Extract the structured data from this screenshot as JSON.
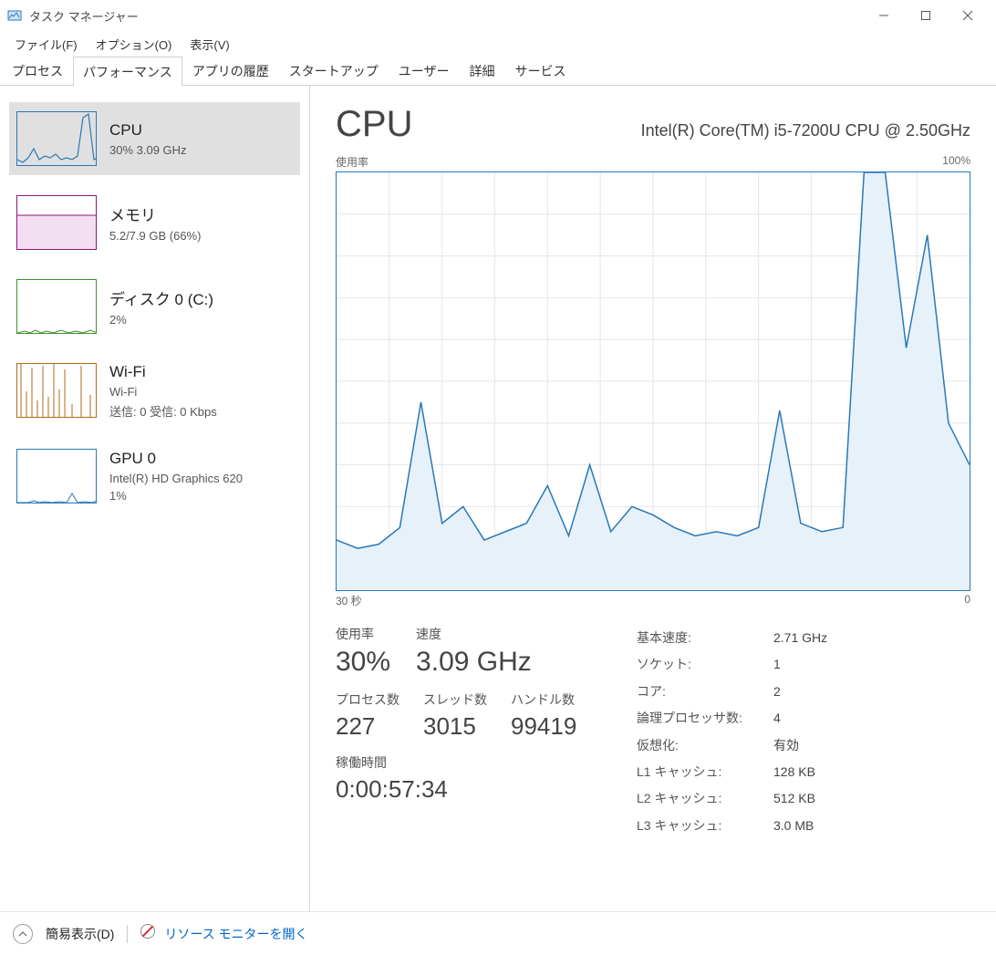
{
  "window": {
    "title": "タスク マネージャー"
  },
  "menu": {
    "file": "ファイル(F)",
    "options": "オプション(O)",
    "view": "表示(V)"
  },
  "tabs": {
    "processes": "プロセス",
    "performance": "パフォーマンス",
    "app_history": "アプリの履歴",
    "startup": "スタートアップ",
    "users": "ユーザー",
    "details": "詳細",
    "services": "サービス"
  },
  "sidebar": {
    "cpu": {
      "title": "CPU",
      "sub": "30%  3.09 GHz",
      "color": "#2878b8"
    },
    "mem": {
      "title": "メモリ",
      "sub": "5.2/7.9 GB (66%)",
      "color": "#8b177d"
    },
    "disk": {
      "title": "ディスク 0 (C:)",
      "sub": "2%",
      "color": "#3f8f2e"
    },
    "wifi": {
      "title": "Wi-Fi",
      "sub": "Wi-Fi",
      "sub2": "送信: 0  受信: 0 Kbps",
      "color": "#b06a1b"
    },
    "gpu": {
      "title": "GPU 0",
      "sub": "Intel(R) HD Graphics 620",
      "sub2": "1%",
      "color": "#2878b8"
    }
  },
  "cpu": {
    "heading": "CPU",
    "model": "Intel(R) Core(TM) i5-7200U CPU @ 2.50GHz",
    "chart_top_left": "使用率",
    "chart_top_right": "100%",
    "chart_bottom_left": "30 秒",
    "chart_bottom_right": "0",
    "stats": {
      "usage_label": "使用率",
      "usage_value": "30%",
      "speed_label": "速度",
      "speed_value": "3.09 GHz",
      "processes_label": "プロセス数",
      "processes_value": "227",
      "threads_label": "スレッド数",
      "threads_value": "3015",
      "handles_label": "ハンドル数",
      "handles_value": "99419",
      "uptime_label": "稼働時間",
      "uptime_value": "0:00:57:34"
    },
    "spec": {
      "base_speed_k": "基本速度:",
      "base_speed_v": "2.71 GHz",
      "sockets_k": "ソケット:",
      "sockets_v": "1",
      "cores_k": "コア:",
      "cores_v": "2",
      "logical_k": "論理プロセッサ数:",
      "logical_v": "4",
      "virt_k": "仮想化:",
      "virt_v": "有効",
      "l1_k": "L1 キャッシュ:",
      "l1_v": "128 KB",
      "l2_k": "L2 キャッシュ:",
      "l2_v": "512 KB",
      "l3_k": "L3 キャッシュ:",
      "l3_v": "3.0 MB"
    }
  },
  "footer": {
    "fewer": "簡易表示(D)",
    "resmon": "リソース モニターを開く"
  },
  "chart_data": {
    "type": "line",
    "title": "CPU 使用率",
    "xlabel": "30 秒",
    "ylabel": "使用率",
    "ylim": [
      0,
      100
    ],
    "x_seconds_ago": [
      30,
      29,
      28,
      27,
      26,
      25,
      24,
      23,
      22,
      21,
      20,
      19,
      18,
      17,
      16,
      15,
      14,
      13,
      12,
      11,
      10,
      9,
      8,
      7,
      6,
      5,
      4,
      3,
      2,
      1,
      0
    ],
    "values": [
      12,
      10,
      11,
      15,
      45,
      16,
      20,
      12,
      14,
      16,
      25,
      13,
      30,
      14,
      20,
      18,
      15,
      13,
      14,
      13,
      15,
      43,
      16,
      14,
      15,
      100,
      100,
      58,
      85,
      40,
      30
    ]
  }
}
